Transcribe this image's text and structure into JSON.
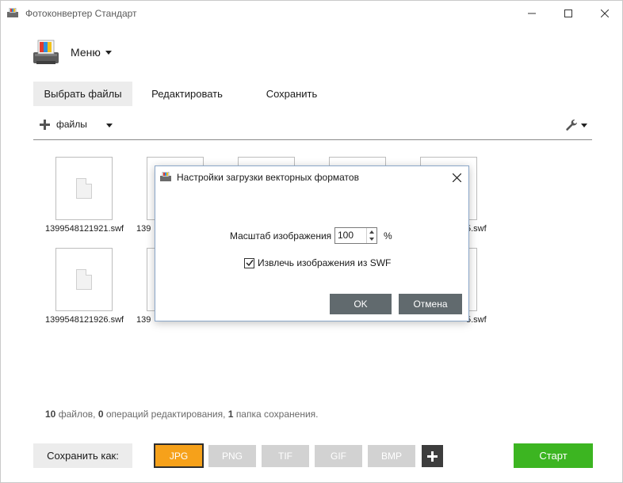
{
  "window": {
    "title": "Фотоконвертер Стандарт"
  },
  "menu": {
    "label": "Меню"
  },
  "tabs": [
    {
      "label": "Выбрать файлы",
      "active": true
    },
    {
      "label": "Редактировать",
      "active": false
    },
    {
      "label": "Сохранить",
      "active": false
    }
  ],
  "toolbar": {
    "add_files_label": "файлы"
  },
  "files": [
    {
      "name": "1399548121921.swf"
    },
    {
      "name": "1399548121926.swf"
    }
  ],
  "partial_labels": {
    "col2_prefix": "139",
    "col5_suffix": "5.swf"
  },
  "status": {
    "files_count": "10",
    "files_text": "файлов,",
    "ops_count": "0",
    "ops_text": "операций редактирования,",
    "folders_count": "1",
    "folders_text": "папка сохранения."
  },
  "bottom": {
    "save_as_label": "Сохранить как:",
    "formats": [
      "JPG",
      "PNG",
      "TIF",
      "GIF",
      "BMP"
    ],
    "selected_format": "JPG",
    "start_label": "Старт"
  },
  "dialog": {
    "title": "Настройки загрузки векторных форматов",
    "scale_label": "Масштаб изображения",
    "scale_value": "100",
    "scale_unit": "%",
    "extract_label": "Извлечь изображения из SWF",
    "extract_checked": true,
    "ok_label": "OK",
    "cancel_label": "Отмена"
  },
  "colors": {
    "accent_selected_format": "#f6a11a",
    "start_button": "#3cb521",
    "dialog_button": "#616a6e",
    "inactive_format": "#d2d2d2"
  }
}
